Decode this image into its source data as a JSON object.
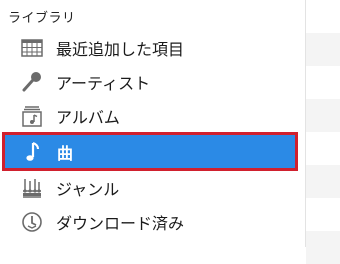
{
  "sidebar": {
    "section_title": "ライブラリ",
    "items": [
      {
        "label": "最近追加した項目",
        "icon": "calendar-grid-icon",
        "selected": false
      },
      {
        "label": "アーティスト",
        "icon": "microphone-icon",
        "selected": false
      },
      {
        "label": "アルバム",
        "icon": "album-icon",
        "selected": false
      },
      {
        "label": "曲",
        "icon": "music-note-icon",
        "selected": true
      },
      {
        "label": "ジャンル",
        "icon": "genre-icon",
        "selected": false
      },
      {
        "label": "ダウンロード済み",
        "icon": "download-clock-icon",
        "selected": false
      }
    ]
  },
  "colors": {
    "selection": "#2b8ae6",
    "highlight_border": "#d0202e"
  }
}
